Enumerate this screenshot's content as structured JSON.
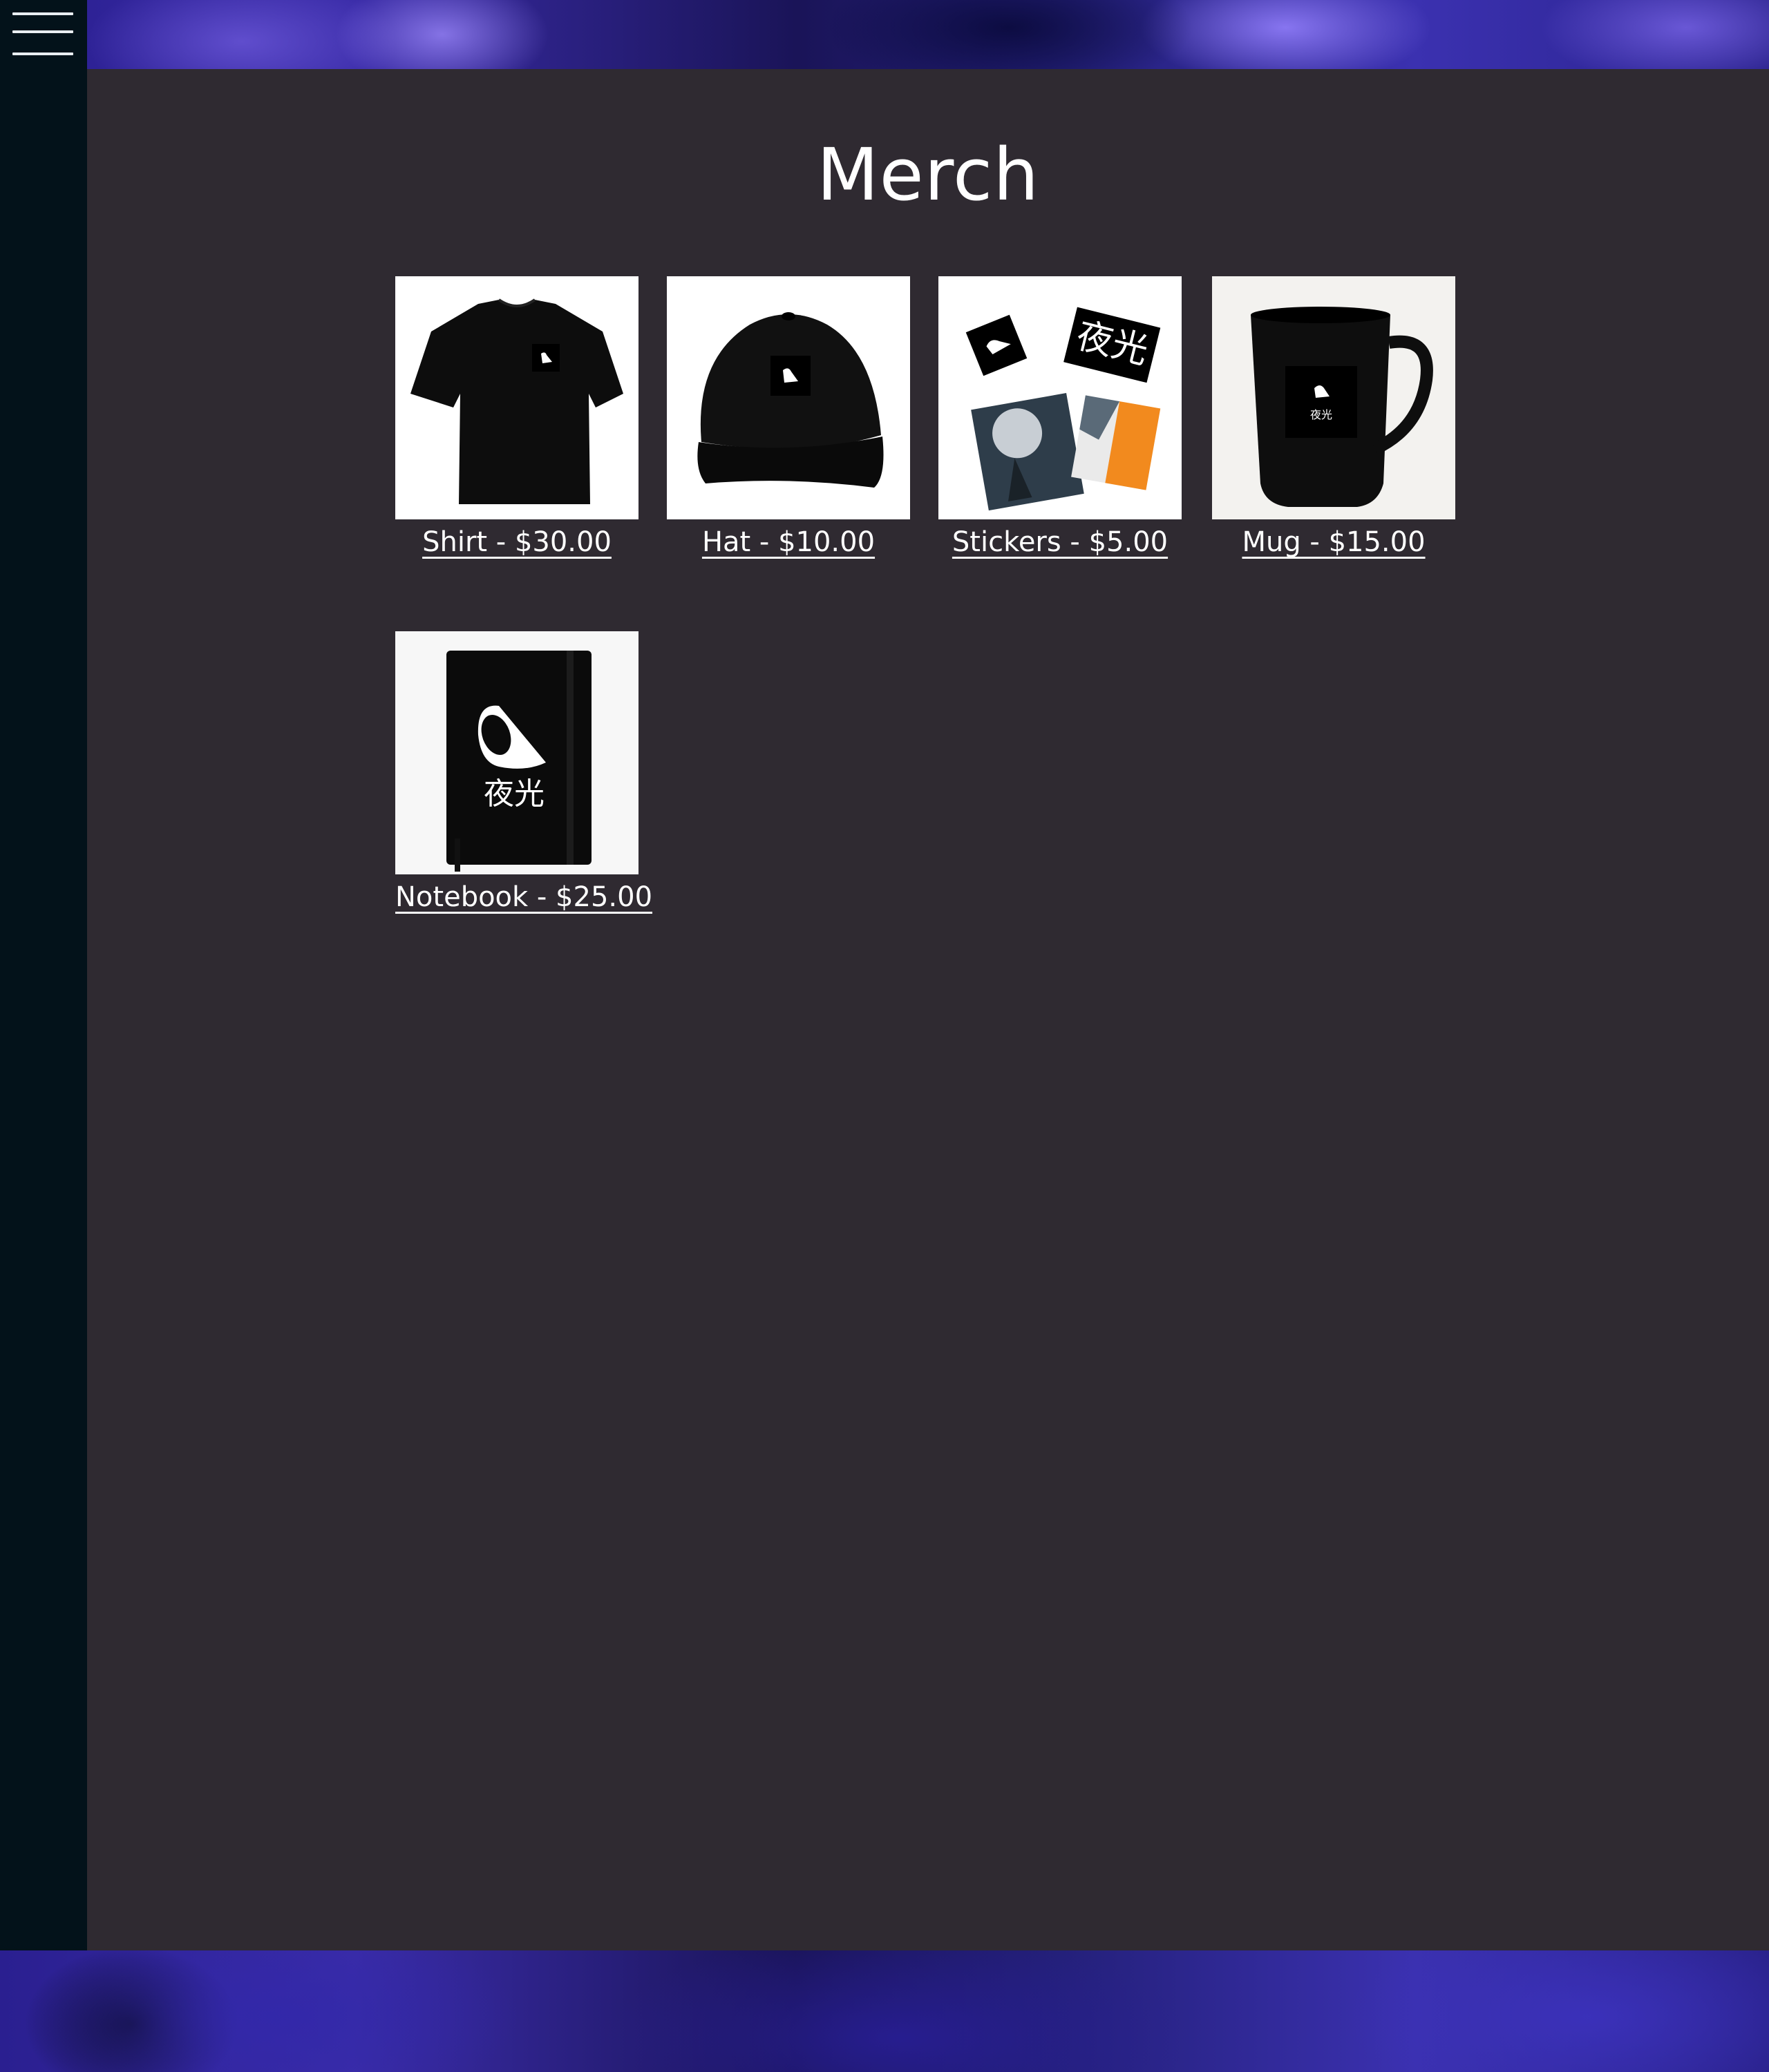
{
  "page": {
    "title": "Merch"
  },
  "menu": {
    "icon": "hamburger-menu-icon"
  },
  "products": [
    {
      "label": "Shirt - $30.00",
      "image": "black-tshirt-logo"
    },
    {
      "label": "Hat - $10.00",
      "image": "black-cap-logo"
    },
    {
      "label": "Stickers - $5.00",
      "image": "sticker-set"
    },
    {
      "label": "Mug - $15.00",
      "image": "black-mug-logo"
    },
    {
      "label": "Notebook - $25.00",
      "image": "black-notebook-logo"
    }
  ],
  "brand": {
    "kanji": "夜光"
  },
  "colors": {
    "sidebar": "#03121a",
    "panel": "#2f2a31",
    "text": "#ffffff",
    "sticker_orange": "#f28a1e"
  }
}
